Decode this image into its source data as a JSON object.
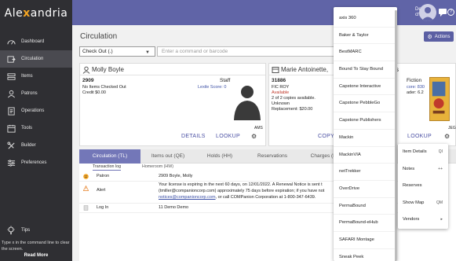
{
  "sidebar": {
    "logo": {
      "pre": "Ale",
      "mid": "x",
      "post": "andria"
    },
    "items": [
      {
        "label": "Dashboard",
        "icon": "dashboard-icon"
      },
      {
        "label": "Circulation",
        "icon": "circulation-icon",
        "active": true
      },
      {
        "label": "Items",
        "icon": "items-icon"
      },
      {
        "label": "Patrons",
        "icon": "patrons-icon"
      },
      {
        "label": "Operations",
        "icon": "operations-icon"
      },
      {
        "label": "Tools",
        "icon": "tools-icon"
      },
      {
        "label": "Builder",
        "icon": "builder-icon"
      },
      {
        "label": "Preferences",
        "icon": "preferences-icon"
      }
    ],
    "tips_label": "Tips",
    "tip_text": "Type x in the command line to clear the screen.",
    "read_more": "Read More"
  },
  "topbar": {
    "user_line1": "Demo",
    "user_line2": "chool",
    "help": "?"
  },
  "main": {
    "title": "Circulation",
    "actions_label": "Actions",
    "command_select": "Check Out (.)",
    "command_placeholder": "Enter a command or barcode"
  },
  "patron": {
    "name": "Molly Boyle",
    "barcode": "2909",
    "type": "Staff",
    "status": "No Items Checked Out",
    "lexile": "Lexile Score: 0",
    "credit": "Credit $0.00",
    "site": "AMS",
    "details_link": "DETAILS",
    "lookup_link": "LOOKUP"
  },
  "item": {
    "title": "Marie Antoinette,",
    "barcode": "31886",
    "call_number": "FIC ROY",
    "availability": "Available",
    "copies": "2 of 2 copies available.",
    "condition": "Unknown",
    "replacement": "Replacement: $20.00",
    "copy_link": "COPY",
    "lookup_link": "LOOKUP"
  },
  "item_extra": {
    "label": "s",
    "genre": "Fiction",
    "score": "core: 830",
    "reader": "ader: 6.2",
    "site": "JEG"
  },
  "tabs": [
    {
      "label": "Circulation (TL)",
      "active": true
    },
    {
      "label": "Items out (QE)"
    },
    {
      "label": "Holds (HH)"
    },
    {
      "label": "Reservations"
    },
    {
      "label": "Charges (F)"
    }
  ],
  "subtabs": [
    {
      "label": "Transaction log",
      "active": true
    },
    {
      "label": "Homeroom (HW)"
    }
  ],
  "log": [
    {
      "label": "Patron",
      "icon": "smiley-icon",
      "message": "2909 Boyle, Molly"
    },
    {
      "label": "Alert",
      "icon": "warning-icon",
      "message_line1": "Your license is expiring in the next 60 days, on 12/01/2022. A Renewal Notice is sent t",
      "message_line2": "(tmiller@companioncorp.com) approximately 75 days before expiration; if you have not",
      "message_line3_link": "notices@companioncorp.com",
      "message_line3_rest": ", or call COMPanion Corporation at 1-800-347-6439."
    },
    {
      "label": "Log In",
      "icon": "document-icon",
      "message": "11 Demo Demo"
    }
  ],
  "vendor_menu": [
    "axis 360",
    "Baker & Taylor",
    "BestMARC",
    "Bound To Stay Bound",
    "Capstone Interactive",
    "Capstone PebbleGo",
    "Capstone Publishers",
    "Mackin",
    "MackinVIA",
    "netTrekker",
    "OverDrive",
    "PermaBound",
    "PermaBound-eHub",
    "SAFARI Montage",
    "Sneak Peek"
  ],
  "context_menu": [
    {
      "label": "Item Details",
      "shortcut": "QI"
    },
    {
      "label": "Notes",
      "shortcut": "++"
    },
    {
      "label": "Reserves",
      "shortcut": ""
    },
    {
      "label": "Show Map",
      "shortcut": "QM"
    },
    {
      "label": "Vendors",
      "shortcut": "▸"
    }
  ],
  "colors": {
    "sidebar": "#2f2f33",
    "topbar": "#6064a7",
    "accent": "#7377b8",
    "link": "#4a4fa3",
    "available": "#c0392b"
  }
}
